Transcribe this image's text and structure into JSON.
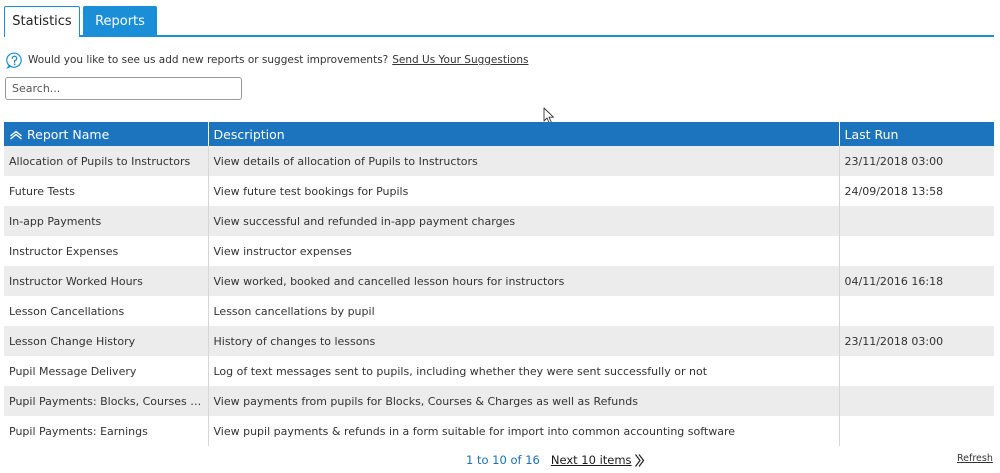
{
  "tabs": [
    {
      "label": "Statistics",
      "active": false
    },
    {
      "label": "Reports",
      "active": true
    }
  ],
  "suggestion": {
    "text": "Would you like to see us add new reports or suggest improvements?",
    "link": "Send Us Your Suggestions",
    "icon": "help-circle-icon"
  },
  "search": {
    "placeholder": "Search...",
    "value": ""
  },
  "table": {
    "columns": [
      "Report Name",
      "Description",
      "Last Run"
    ],
    "sort_icon": "sort-ascending-icon",
    "rows": [
      {
        "name": "Allocation of Pupils to Instructors",
        "description": "View details of allocation of Pupils to Instructors",
        "last_run": "23/11/2018 03:00"
      },
      {
        "name": "Future Tests",
        "description": "View future test bookings for Pupils",
        "last_run": "24/09/2018 13:58"
      },
      {
        "name": "In-app Payments",
        "description": "View successful and refunded in-app payment charges",
        "last_run": ""
      },
      {
        "name": "Instructor Expenses",
        "description": "View instructor expenses",
        "last_run": ""
      },
      {
        "name": "Instructor Worked Hours",
        "description": "View worked, booked and cancelled lesson hours for instructors",
        "last_run": "04/11/2016 16:18"
      },
      {
        "name": "Lesson Cancellations",
        "description": "Lesson cancellations by pupil",
        "last_run": ""
      },
      {
        "name": "Lesson Change History",
        "description": "History of changes to lessons",
        "last_run": "23/11/2018 03:00"
      },
      {
        "name": "Pupil Message Delivery",
        "description": "Log of text messages sent to pupils, including whether they were sent successfully or not",
        "last_run": ""
      },
      {
        "name": "Pupil Payments: Blocks, Courses & ...",
        "description": "View payments from pupils for Blocks, Courses & Charges as well as Refunds",
        "last_run": ""
      },
      {
        "name": "Pupil Payments: Earnings",
        "description": "View pupil payments & refunds in a form suitable for import into common accounting software",
        "last_run": ""
      }
    ]
  },
  "pagination": {
    "range": "1 to 10 of 16",
    "next_label": "Next 10 items",
    "next_icon": "double-chevron-right-icon"
  },
  "refresh_label": "Refresh",
  "colors": {
    "accent": "#1a8fd8",
    "header": "#1c74bf",
    "row_alt": "#ececec"
  }
}
